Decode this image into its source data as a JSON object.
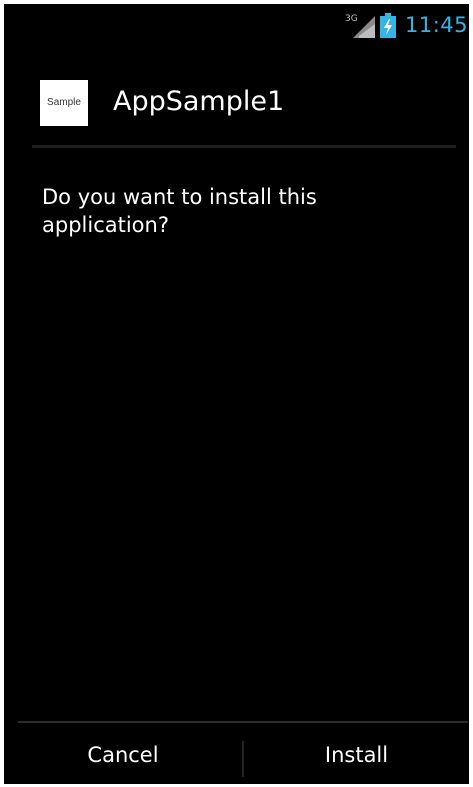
{
  "status_bar": {
    "network_label": "3G",
    "time": "11:45",
    "time_color": "#33b5e5",
    "signal_icon": "signal-strength-icon",
    "battery_icon": "battery-charging-icon"
  },
  "dialog": {
    "app_icon_text": "Sample",
    "app_name": "AppSample1",
    "message": "Do you want to install this application?"
  },
  "buttons": {
    "cancel_label": "Cancel",
    "install_label": "Install"
  }
}
